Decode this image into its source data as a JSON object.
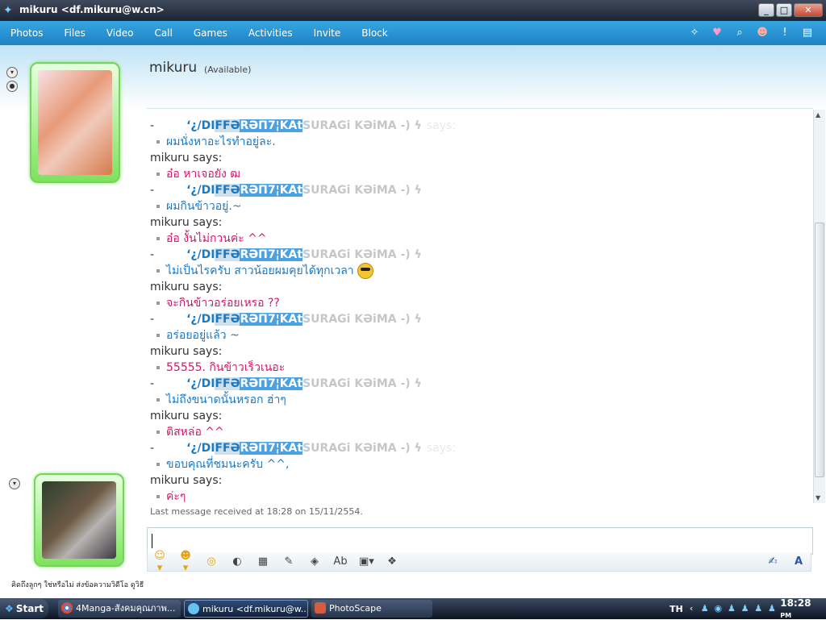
{
  "window": {
    "title": "mikuru <df.mikuru@w.cn>",
    "buttons": {
      "minimize": "_",
      "maximize": "□",
      "close": "✕"
    }
  },
  "menu": [
    "Photos",
    "Files",
    "Video",
    "Call",
    "Games",
    "Activities",
    "Invite",
    "Block"
  ],
  "contact": {
    "name": "mikuru",
    "status": "(Available)"
  },
  "nick": {
    "dash": "-",
    "p1": "‘¿/DI",
    "p2": "FFƏ",
    "p3": "RƏΠ7¦KAt",
    "p4": "SURAGi  KƏiMA -) ϟ",
    "ghost": "says:"
  },
  "messages": [
    {
      "kind": "nick",
      "ghost": true
    },
    {
      "kind": "msg",
      "who": "other",
      "text": "ผมนั่งหาอะไรทำอยู่ละ."
    },
    {
      "kind": "sender",
      "text": "mikuru says:"
    },
    {
      "kind": "msg",
      "who": "me",
      "text": "อ๋อ หาเจอยัง ฒ"
    },
    {
      "kind": "nick"
    },
    {
      "kind": "msg",
      "who": "other",
      "text": "ผมกินข้าวอยู่.~"
    },
    {
      "kind": "sender",
      "text": "mikuru says:"
    },
    {
      "kind": "msg",
      "who": "me",
      "text": "อ๋อ งั้นไม่กวนค่ะ ^^"
    },
    {
      "kind": "nick"
    },
    {
      "kind": "msg",
      "who": "other",
      "text": "ไม่เป็นไรครับ สาวน้อยผมคุยได้ทุกเวลา",
      "emoji": true
    },
    {
      "kind": "sender",
      "text": "mikuru says:"
    },
    {
      "kind": "msg",
      "who": "me",
      "text": "จะกินข้าวอร่อยเหรอ ??"
    },
    {
      "kind": "nick"
    },
    {
      "kind": "msg",
      "who": "other",
      "text": "อร่อยอยู่แล้ว ~"
    },
    {
      "kind": "sender",
      "text": "mikuru says:"
    },
    {
      "kind": "msg",
      "who": "me",
      "text": "55555. กินข้าวเร็วเนอะ"
    },
    {
      "kind": "nick"
    },
    {
      "kind": "msg",
      "who": "other",
      "text": "ไม่ถึงขนาดนั้นหรอก ฮ่าๆ"
    },
    {
      "kind": "sender",
      "text": "mikuru says:"
    },
    {
      "kind": "msg",
      "who": "me",
      "text": "ติสหล่อ ^^"
    },
    {
      "kind": "nick",
      "ghost": true
    },
    {
      "kind": "msg",
      "who": "other",
      "text": "ขอบคุณที่ชมนะครับ ^^,"
    },
    {
      "kind": "sender",
      "text": "mikuru says:"
    },
    {
      "kind": "msg",
      "who": "me",
      "text": "ค่ะๆ"
    }
  ],
  "last_message": "Last message received at 18:28 on 15/11/2554.",
  "personal_message": "คิดถึงลูกๆ ใช่หรือไม่  ส่งข้อความวิดีโอ ดูวิธี",
  "taskbar": {
    "start": "Start",
    "tasks": [
      "4Manga-สังคมคุณภาพ...",
      "mikuru <df.mikuru@w...",
      "PhotoScape"
    ],
    "lang": "TH",
    "clock": "18:28",
    "clock_period": "PM"
  }
}
